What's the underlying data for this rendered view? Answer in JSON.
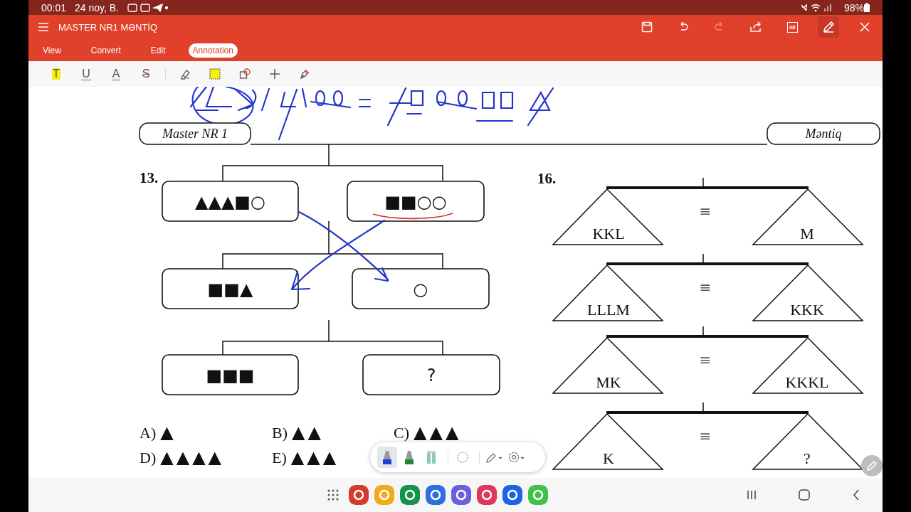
{
  "status_bar": {
    "time": "00:01",
    "date": "24 noy, B.",
    "battery": "98%"
  },
  "app_bar": {
    "title": "MASTER NR1 MƏNTİQ",
    "actions": [
      {
        "kind": "save",
        "disabled": false,
        "selected": false
      },
      {
        "kind": "undo",
        "disabled": false,
        "selected": false
      },
      {
        "kind": "redo",
        "disabled": true,
        "selected": false
      },
      {
        "kind": "share",
        "disabled": false,
        "selected": false
      },
      {
        "kind": "pages",
        "label": "48",
        "disabled": false,
        "selected": false
      },
      {
        "kind": "pen",
        "disabled": false,
        "selected": true
      },
      {
        "kind": "close",
        "disabled": false,
        "selected": false
      }
    ],
    "tabs": [
      {
        "label": "View",
        "selected": false
      },
      {
        "label": "Convert",
        "selected": false
      },
      {
        "label": "Edit",
        "selected": false
      },
      {
        "label": "Annotation",
        "selected": true
      }
    ]
  },
  "tools": [
    {
      "kind": "highlight",
      "label": "T",
      "selected": false
    },
    {
      "kind": "underline",
      "label": "U",
      "selected": false
    },
    {
      "kind": "color-text",
      "label": "A",
      "selected": false
    },
    {
      "kind": "strike",
      "label": "S",
      "selected": false
    },
    {
      "kind": "eraser",
      "selected": false
    },
    {
      "kind": "area",
      "selected": false
    },
    {
      "kind": "shape",
      "selected": false
    },
    {
      "kind": "plus",
      "selected": false
    },
    {
      "kind": "signature",
      "selected": false
    }
  ],
  "document": {
    "header_left": "Master NR 1",
    "header_right": "Məntiq",
    "problem_13": {
      "number": "13.",
      "rows": [
        [
          "▲▲▲■○",
          "■■○○"
        ],
        [
          "■■▲",
          "○"
        ],
        [
          "■■■",
          "?"
        ]
      ],
      "options": [
        {
          "letter": "A)",
          "shapes": "▲"
        },
        {
          "letter": "B)",
          "shapes": "▲▲"
        },
        {
          "letter": "C)",
          "shapes": "▲▲▲"
        },
        {
          "letter": "D)",
          "shapes": "▲▲▲▲"
        },
        {
          "letter": "E)",
          "shapes": "▲▲▲"
        }
      ]
    },
    "problem_16": {
      "number": "16.",
      "balances": [
        {
          "left": "KKL",
          "sign": "≡",
          "right": "M"
        },
        {
          "left": "LLLM",
          "sign": "≡",
          "right": "KKK"
        },
        {
          "left": "MK",
          "sign": "≡",
          "right": "KKKL"
        },
        {
          "left": "K",
          "sign": "≡",
          "right": "?"
        }
      ]
    }
  },
  "pen_toolbar": [
    {
      "kind": "pen",
      "color": "#1f3fd6",
      "selected": true
    },
    {
      "kind": "pen",
      "color": "#1c8a32",
      "selected": false
    },
    {
      "kind": "eraser",
      "selected": false
    },
    {
      "kind": "lasso",
      "selected": false
    },
    {
      "kind": "pencil-menu",
      "selected": false
    },
    {
      "kind": "settings-menu",
      "selected": false
    }
  ]
}
